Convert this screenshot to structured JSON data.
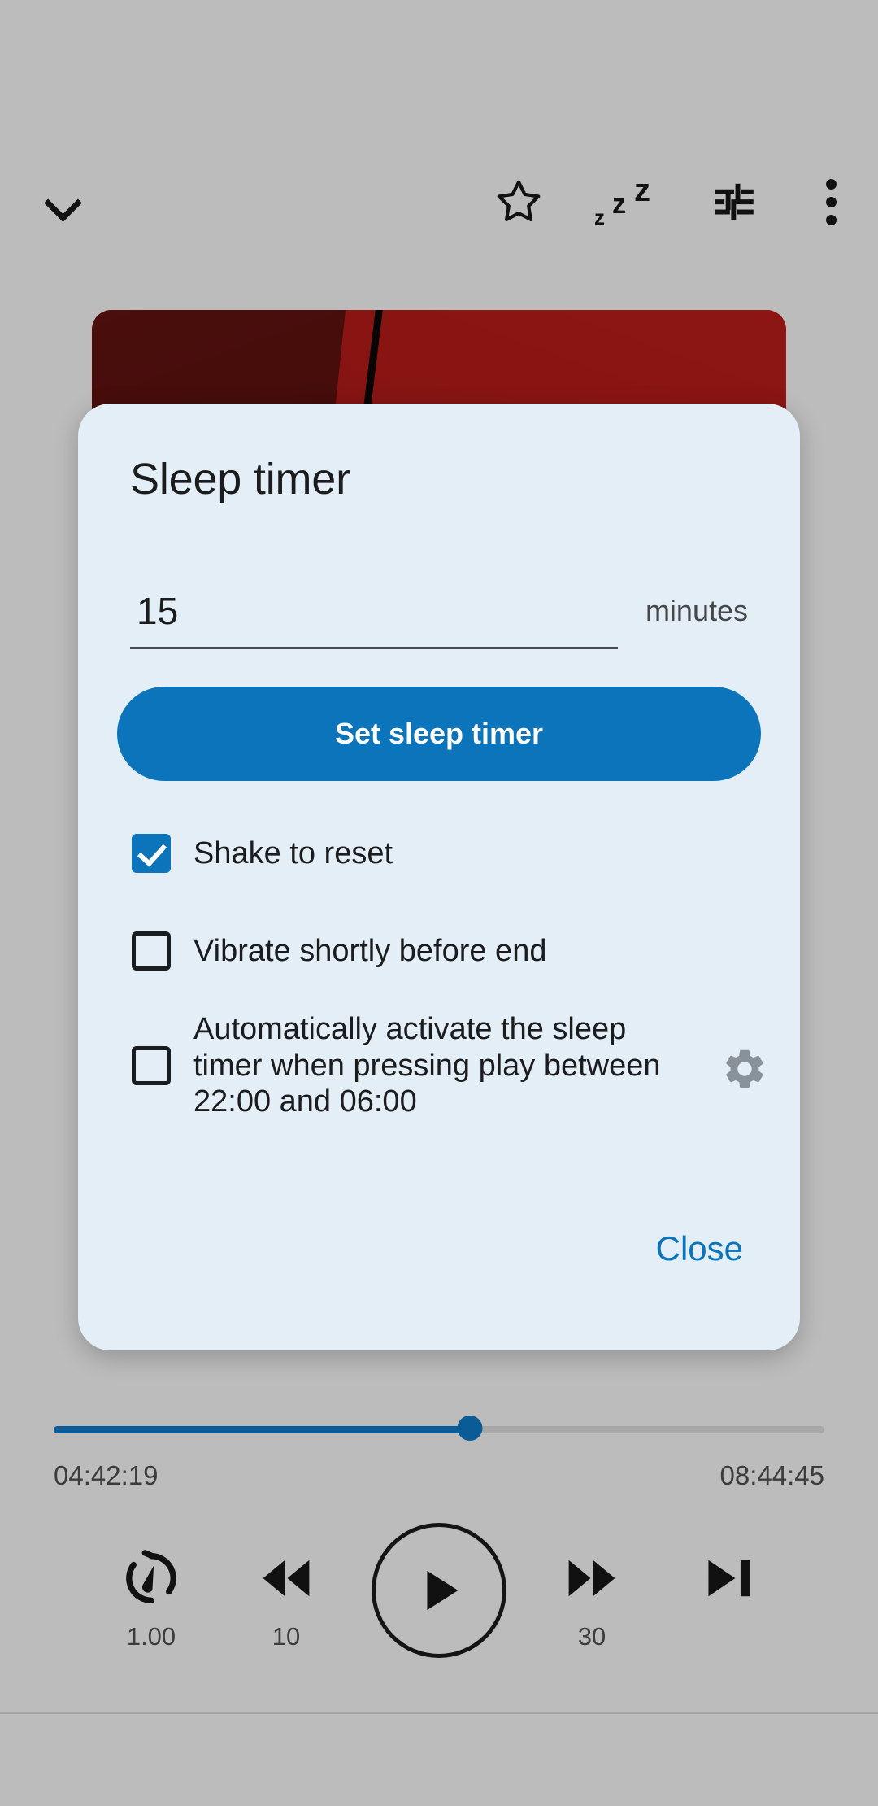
{
  "appbar": {
    "collapse_icon": "chevron-down-icon",
    "favorite_icon": "star-outline-icon",
    "sleep_icon": "zzz-sleep-icon",
    "sleep_glyph_1": "z",
    "sleep_glyph_2": "z",
    "sleep_glyph_3": "z",
    "tune_icon": "tune-sliders-icon",
    "more_icon": "overflow-menu-icon"
  },
  "artwork": {
    "name": "album-artwork",
    "primary_color": "#8d1613",
    "shadow_color": "#3d0a09"
  },
  "dialog": {
    "title": "Sleep timer",
    "background_color": "#e4eef7",
    "accent_color": "#0b74bb",
    "minutes": {
      "value": "15",
      "placeholder": "15",
      "unit_label": "minutes"
    },
    "set_button_label": "Set sleep timer",
    "options": [
      {
        "id": "shake-to-reset",
        "label": "Shake to reset",
        "checked": true
      },
      {
        "id": "vibrate-before-end",
        "label": "Vibrate shortly before end",
        "checked": false
      },
      {
        "id": "auto-activate",
        "label": "Automatically activate the sleep timer when pressing play between 22:00 and 06:00",
        "checked": false,
        "settings_icon": "gear-icon"
      }
    ],
    "close_label": "Close"
  },
  "player": {
    "elapsed": "04:42:19",
    "total": "08:44:45",
    "progress_percent": 54,
    "controls": {
      "speed_icon": "playback-speed-icon",
      "speed_value": "1.00",
      "rewind_icon": "rewind-icon",
      "rewind_seconds": "10",
      "play_icon": "play-icon",
      "forward_icon": "fast-forward-icon",
      "forward_seconds": "30",
      "next_icon": "skip-next-icon"
    }
  }
}
